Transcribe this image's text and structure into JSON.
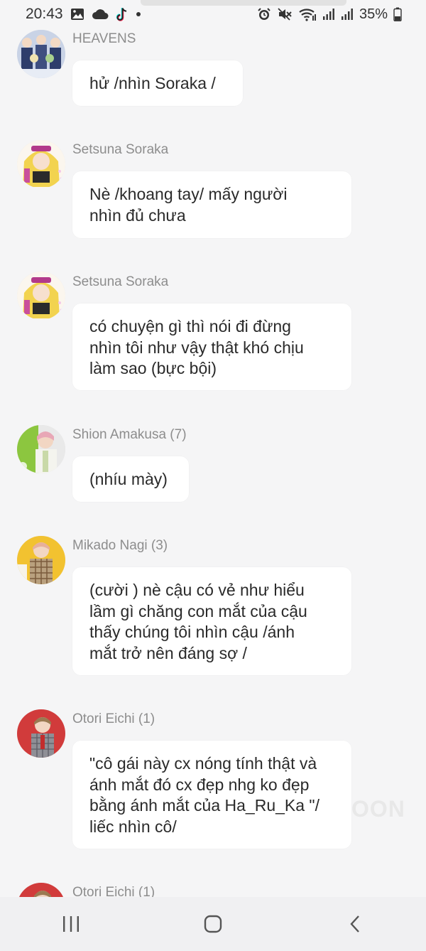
{
  "status_bar": {
    "time": "20:43",
    "battery_text": "35%",
    "left_icons": [
      "image-icon",
      "cloud-icon",
      "tiktok-icon",
      "dot-icon"
    ],
    "right_icons": [
      "alarm-icon",
      "mute-icon",
      "wifi-icon",
      "signal-icon",
      "signal-icon",
      "battery-icon"
    ]
  },
  "messages": [
    {
      "sender": "HEAVENS",
      "text": "hử /nhìn Soraka /",
      "avatar_color": "#7d93b8"
    },
    {
      "sender": "Setsuna Soraka",
      "text": "Nè /khoang tay/ mấy người\nnhìn đủ chưa",
      "avatar_color": "#e7c84b"
    },
    {
      "sender": "Setsuna Soraka",
      "text": "có chuyện gì thì nói đi đừng\nnhìn tôi như vậy thật khó chịu\nlàm sao (bực bội)",
      "avatar_color": "#e7c84b"
    },
    {
      "sender": "Shion Amakusa (7)",
      "text": "(nhíu mày)",
      "avatar_color": "#8cc63f"
    },
    {
      "sender": "Mikado Nagi (3)",
      "text": "(cười ) nè cậu có vẻ như hiểu\nlầm gì chăng con mắt của cậu\nthấy chúng tôi nhìn cậu /ánh\nmắt trở nên đáng sợ /",
      "avatar_color": "#f2c230"
    },
    {
      "sender": "Otori Eichi (1)",
      "text": "\"cô gái này cx nóng tính thật và\nánh mắt đó cx đẹp nhg ko đẹp\nbằng ánh mắt của Ha_Ru_Ka \"/\nliếc nhìn cô/",
      "avatar_color": "#d13b3b"
    },
    {
      "sender": "Otori Eichi (1)",
      "text": "",
      "avatar_color": "#d13b3b"
    }
  ],
  "watermark": "OON",
  "nav": {
    "icons": [
      "recent-apps-icon",
      "home-icon",
      "back-icon"
    ]
  }
}
